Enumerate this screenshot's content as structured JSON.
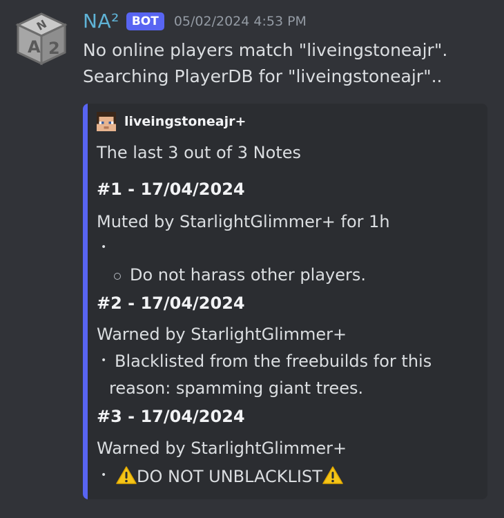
{
  "message": {
    "author": "NA²",
    "badge": "BOT",
    "timestamp": "05/02/2024 4:53 PM",
    "line1": "No online players match \"liveingstoneajr\".",
    "line2": "Searching PlayerDB for \"liveingstoneajr\".."
  },
  "embed": {
    "accent_color": "#5865f2",
    "author_name": "liveingstoneajr+",
    "description": "The last 3 out of 3 Notes",
    "fields": [
      {
        "title": "#1 - 17/04/2024",
        "action": "Muted by StarlightGlimmer+ for 1h",
        "sub_item": "Do not harass other players."
      },
      {
        "title": "#2 - 17/04/2024",
        "action": "Warned by StarlightGlimmer+",
        "item_line1": "Blacklisted from the freebuilds for this",
        "item_line2": "reason: spamming giant trees."
      },
      {
        "title": "#3 - 17/04/2024",
        "action": "Warned by StarlightGlimmer+",
        "item": "DO NOT UNBLACKLIST"
      }
    ]
  },
  "icons": {
    "avatar": "na2-cube-avatar",
    "author_icon": "player-head-icon",
    "warning": "warning-emoji-icon"
  }
}
